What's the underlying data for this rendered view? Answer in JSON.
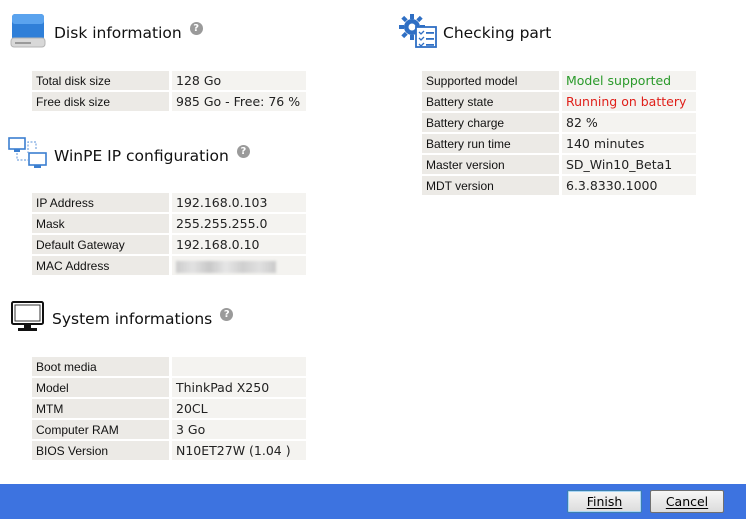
{
  "disk": {
    "title": "Disk information",
    "rows": [
      {
        "label": "Total disk size",
        "value": "128 Go"
      },
      {
        "label": "Free disk size",
        "value": "985 Go - Free: 76 %"
      }
    ]
  },
  "network": {
    "title": "WinPE IP configuration",
    "rows": [
      {
        "label": "IP Address",
        "value": "192.168.0.103"
      },
      {
        "label": "Mask",
        "value": "255.255.255.0"
      },
      {
        "label": "Default Gateway",
        "value": "192.168.0.10"
      },
      {
        "label": "MAC Address",
        "value": ""
      }
    ]
  },
  "system": {
    "title": "System informations",
    "rows": [
      {
        "label": "Boot media",
        "value": ""
      },
      {
        "label": "Model",
        "value": "ThinkPad X250"
      },
      {
        "label": "MTM",
        "value": "20CL"
      },
      {
        "label": "Computer RAM",
        "value": "3 Go"
      },
      {
        "label": "BIOS Version",
        "value": "N10ET27W (1.04 )"
      }
    ]
  },
  "checking": {
    "title": "Checking part",
    "rows": [
      {
        "label": "Supported model",
        "value": "Model supported",
        "color": "#2a9a2a"
      },
      {
        "label": "Battery state",
        "value": "Running on battery",
        "color": "#e0201a"
      },
      {
        "label": "Battery charge",
        "value": "82 %"
      },
      {
        "label": "Battery run time",
        "value": "140 minutes"
      },
      {
        "label": "Master version",
        "value": "SD_Win10_Beta1"
      },
      {
        "label": "MDT version",
        "value": "6.3.8330.1000"
      }
    ]
  },
  "help_glyph": "?",
  "buttons": {
    "finish": "Finish",
    "cancel": "Cancel"
  },
  "colors": {
    "footer": "#3d73e0",
    "ok": "#2a9a2a",
    "warn": "#e0201a"
  }
}
